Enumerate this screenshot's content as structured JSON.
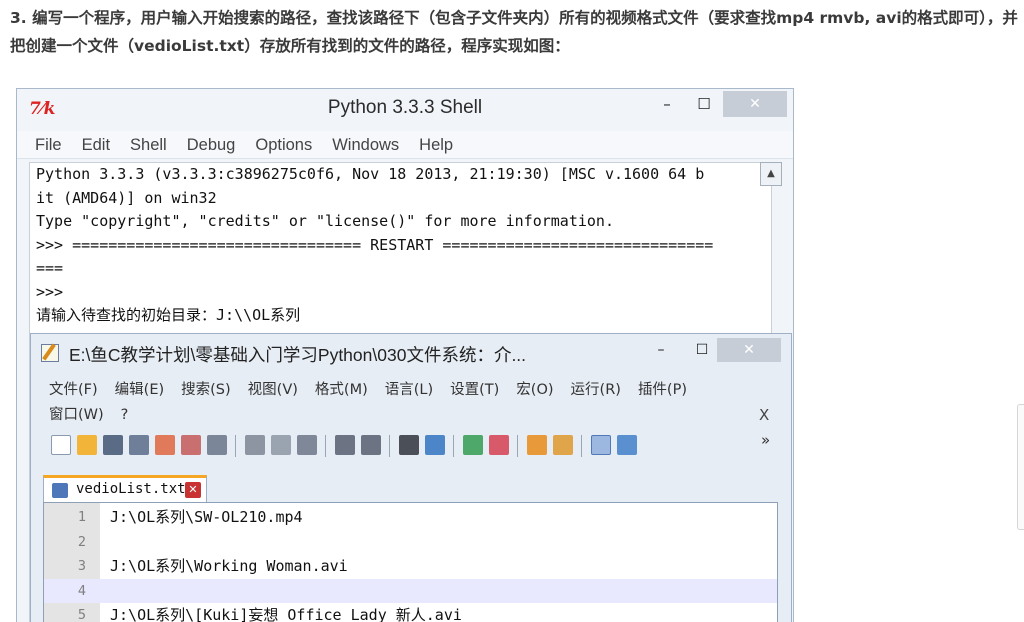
{
  "question": {
    "text": "3. 编写一个程序，用户输入开始搜索的路径，查找该路径下（包含子文件夹内）所有的视频格式文件（要求查找mp4 rmvb, avi的格式即可），并把创建一个文件（vedioList.txt）存放所有找到的文件的路径，程序实现如图："
  },
  "shell_window": {
    "logo": "7⁄k",
    "title": "Python 3.3.3 Shell",
    "min_label": "–",
    "max_label": "☐",
    "close_label": "✕",
    "menu": [
      "File",
      "Edit",
      "Shell",
      "Debug",
      "Options",
      "Windows",
      "Help"
    ],
    "lines": [
      "Python 3.3.3 (v3.3.3:c3896275c0f6, Nov 18 2013, 21:19:30) [MSC v.1600 64 b",
      "it (AMD64)] on win32",
      "Type \"copyright\", \"credits\" or \"license()\" for more information.",
      ">>> ================================ RESTART ==============================",
      "===",
      ">>> ",
      "请输入待查找的初始目录：J:\\\\OL系列"
    ],
    "scroll_up_icon": "▲"
  },
  "npp_window": {
    "title": "E:\\鱼C教学计划\\零基础入门学习Python\\030文件系统：介...",
    "min_label": "–",
    "max_label": "☐",
    "close_label": "✕",
    "menu_row1": [
      "文件(F)",
      "编辑(E)",
      "搜索(S)",
      "视图(V)",
      "格式(M)",
      "语言(L)",
      "设置(T)",
      "宏(O)",
      "运行(R)",
      "插件(P)"
    ],
    "menu_row2": [
      "窗口(W)",
      "?"
    ],
    "menu_close": "X",
    "toolbar_more": "»",
    "tab": {
      "label": "vedioList.txt",
      "close_label": "✕"
    },
    "lines": [
      {
        "num": "1",
        "text": "J:\\OL系列\\SW-OL210.mp4"
      },
      {
        "num": "2",
        "text": ""
      },
      {
        "num": "3",
        "text": "J:\\OL系列\\Working Woman.avi"
      },
      {
        "num": "4",
        "text": ""
      },
      {
        "num": "5",
        "text": "J:\\OL系列\\[Kuki]妄想 Office Lady 新人.avi"
      }
    ]
  },
  "colors": {
    "prompt": "#b8261c",
    "input_text": "#1a1acc",
    "tab_accent": "#f5a623",
    "current_line": "#e8e8ff"
  }
}
